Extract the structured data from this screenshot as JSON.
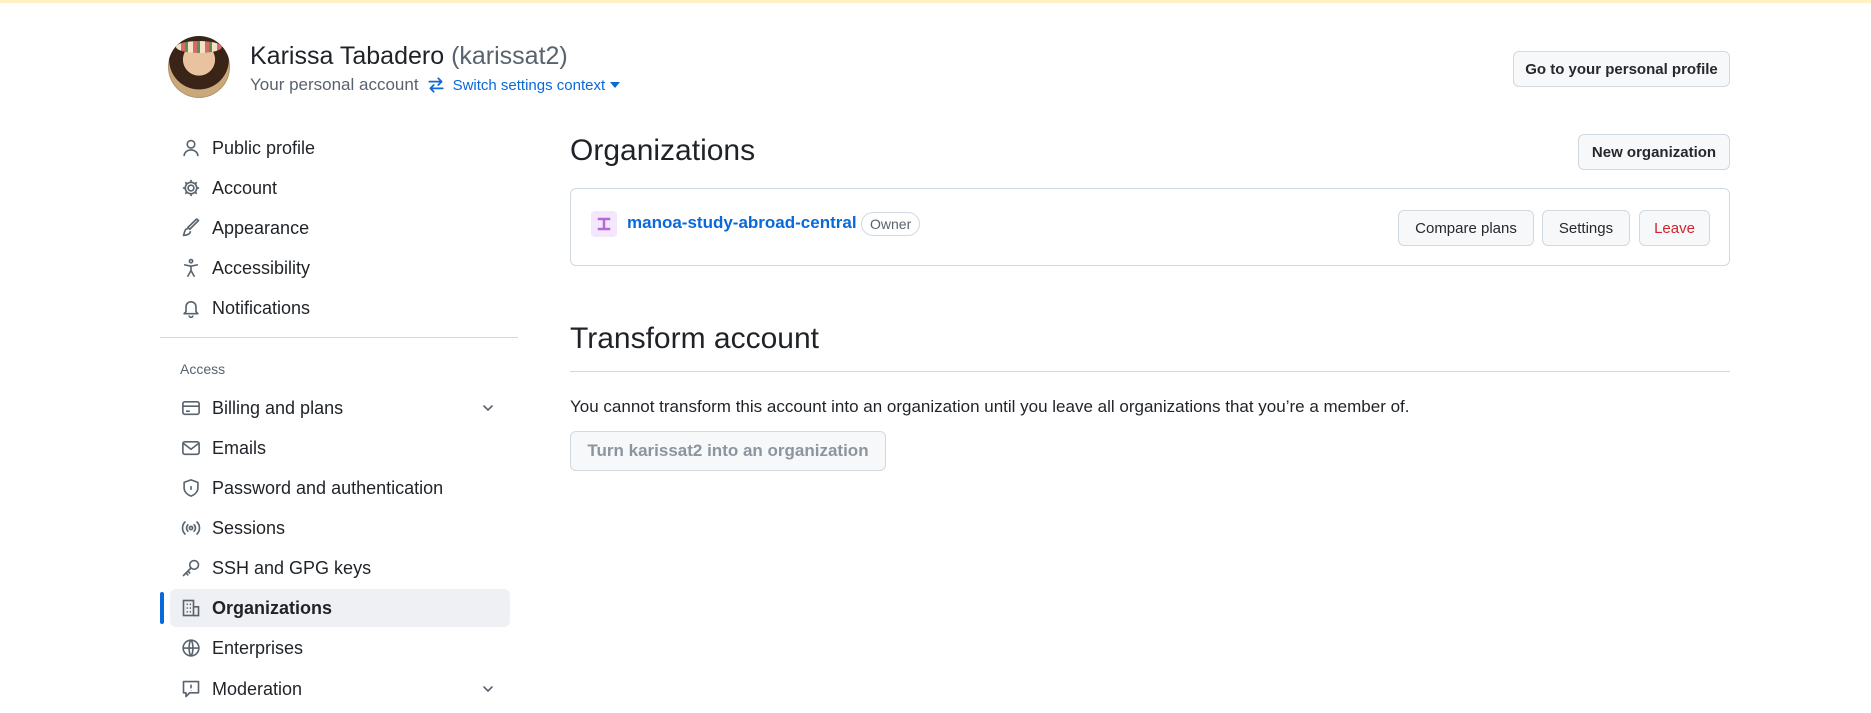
{
  "header": {
    "display_name": "Karissa Tabadero",
    "handle": "(karissat2)",
    "subtitle": "Your personal account",
    "switch_context_label": "Switch settings context",
    "profile_button_label": "Go to your personal profile"
  },
  "sidebar": {
    "items": [
      {
        "label": "Public profile",
        "icon": "person-icon"
      },
      {
        "label": "Account",
        "icon": "gear-icon"
      },
      {
        "label": "Appearance",
        "icon": "paintbrush-icon"
      },
      {
        "label": "Accessibility",
        "icon": "accessibility-icon"
      },
      {
        "label": "Notifications",
        "icon": "bell-icon"
      }
    ],
    "access_heading": "Access",
    "access_items": [
      {
        "label": "Billing and plans",
        "icon": "credit-card-icon",
        "expandable": true
      },
      {
        "label": "Emails",
        "icon": "mail-icon"
      },
      {
        "label": "Password and authentication",
        "icon": "shield-lock-icon"
      },
      {
        "label": "Sessions",
        "icon": "broadcast-icon"
      },
      {
        "label": "SSH and GPG keys",
        "icon": "key-icon"
      },
      {
        "label": "Organizations",
        "icon": "organization-icon",
        "active": true
      },
      {
        "label": "Enterprises",
        "icon": "globe-icon"
      },
      {
        "label": "Moderation",
        "icon": "report-icon",
        "expandable": true
      }
    ]
  },
  "main": {
    "organizations_title": "Organizations",
    "new_org_button": "New organization",
    "orgs": [
      {
        "name": "manoa-study-abroad-central",
        "role": "Owner",
        "actions": {
          "compare": "Compare plans",
          "settings": "Settings",
          "leave": "Leave"
        }
      }
    ],
    "transform_title": "Transform account",
    "transform_text": "You cannot transform this account into an organization until you leave all organizations that you’re a member of.",
    "transform_button": "Turn karissat2 into an organization"
  },
  "colors": {
    "accent": "#0969da",
    "danger": "#d1242f",
    "active_bg": "#eef0f3",
    "border": "#d1d9e0"
  }
}
